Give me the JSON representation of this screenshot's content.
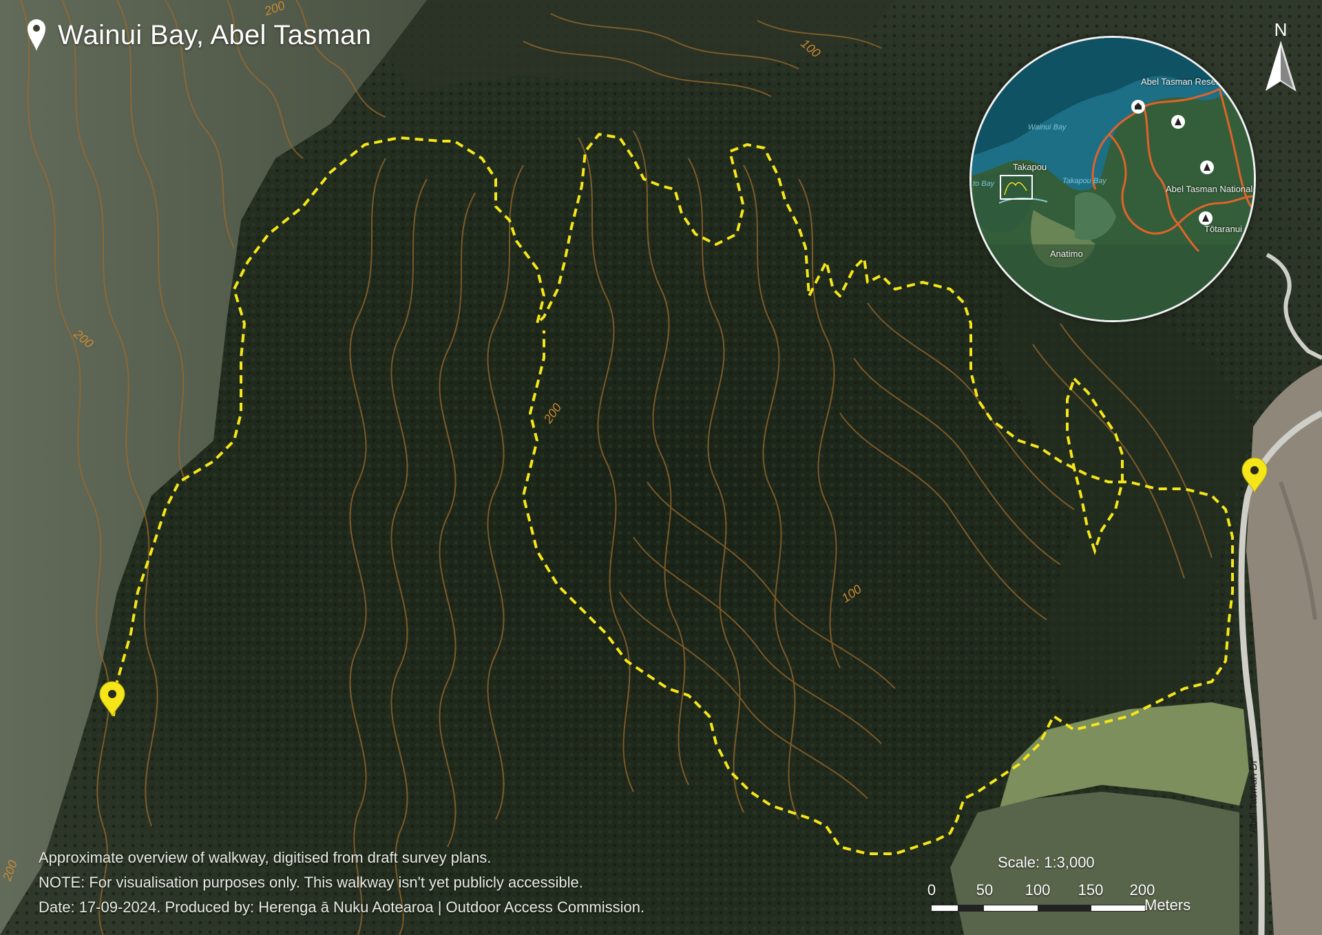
{
  "title": "Wainui Bay, Abel Tasman",
  "notes": [
    "Approximate overview of walkway, digitised from draft survey plans.",
    "NOTE: For visualisation purposes only. This walkway isn't yet publicly accessible.",
    "Date: 17-09-2024. Produced by: Herenga ā Nuku Aotearoa | Outdoor Access Commission."
  ],
  "north_label": "N",
  "contour_labels": [
    "200",
    "100",
    "200",
    "200",
    "100",
    "200"
  ],
  "road_label": "Abel Tasman Dr",
  "scale": {
    "title": "Scale: 1:3,000",
    "ticks": [
      "0",
      "50",
      "100",
      "150",
      "200"
    ],
    "units": "Meters"
  },
  "inset": {
    "labels": [
      "Abel Tasman Reserve",
      "Abel Tasman National Park",
      "Tōtaranui",
      "Takapou",
      "Anatimo"
    ],
    "water_labels": [
      "Wainui Bay",
      "Takapou Bay",
      "to Bay"
    ]
  },
  "colors": {
    "walkway": "#f5e61a",
    "contour": "#9a6a2e",
    "contour_label": "#c98a33",
    "forest": "#1f2a1c",
    "open_hillside": "#5b6352",
    "pasture": "#7d8f5c",
    "estuary": "#8f877a",
    "road": "#cfcfc8",
    "inset_track": "#e0632a",
    "inset_sea": "#1d6f86",
    "text": "#ffffff"
  },
  "icons": [
    "location-pin-icon",
    "start-marker-icon",
    "end-marker-icon",
    "north-arrow-icon",
    "campsite-icon",
    "hut-icon"
  ]
}
